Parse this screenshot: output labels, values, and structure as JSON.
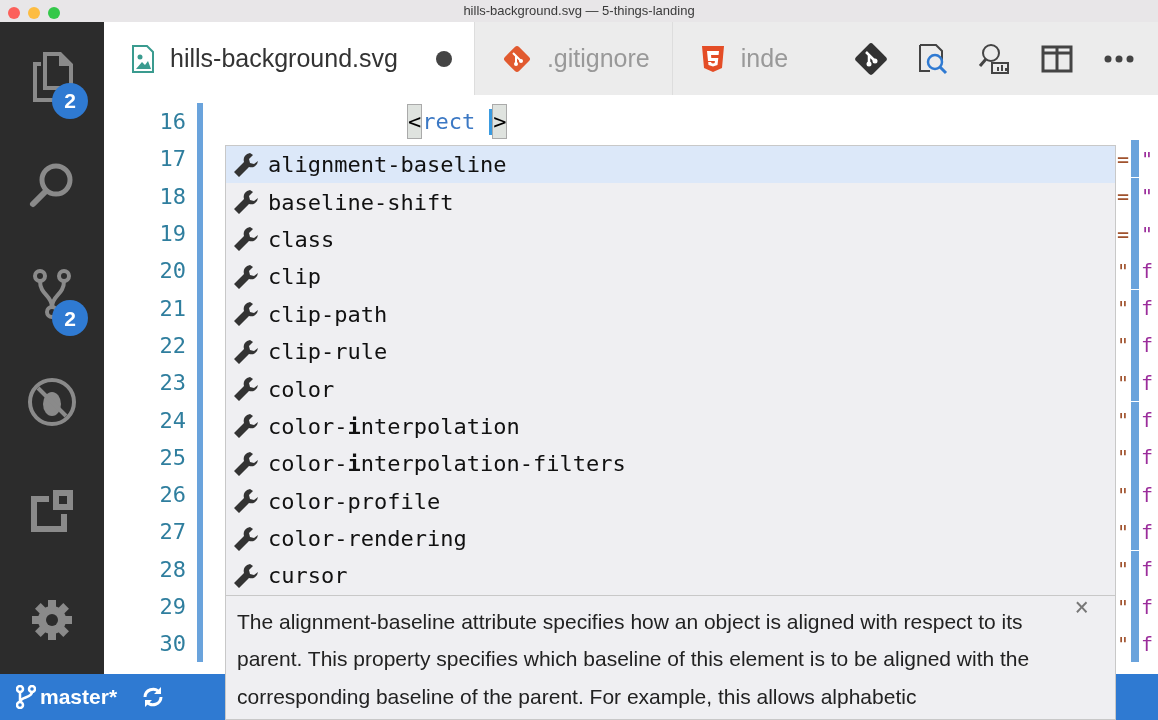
{
  "window": {
    "title": "hills-background.svg — 5-things-landing"
  },
  "activity_bar": [
    {
      "kind": "files",
      "badge": "2"
    },
    {
      "kind": "search"
    },
    {
      "kind": "source-control",
      "badge": "2"
    },
    {
      "kind": "debug"
    },
    {
      "kind": "extensions"
    }
  ],
  "tabs": [
    {
      "label": "hills-background.svg",
      "kind": "image",
      "selected": true,
      "dirty": true
    },
    {
      "label": ".gitignore",
      "kind": "git",
      "selected": false,
      "dirty": false
    },
    {
      "label": "inde",
      "kind": "html",
      "selected": false,
      "dirty": false
    }
  ],
  "editor": {
    "lines": [
      {
        "number": "16",
        "tokens": [
          {
            "text": "<",
            "kind": "bracket"
          },
          {
            "text": "rect",
            "kind": "tag"
          },
          {
            "text": ">",
            "kind": "bracket"
          }
        ]
      },
      {
        "number": "17",
        "edge_left": "=",
        "edge_right": "\""
      },
      {
        "number": "18",
        "edge_left": "=",
        "edge_right": "\""
      },
      {
        "number": "19",
        "edge_left": "=",
        "edge_right": "\""
      },
      {
        "number": "20",
        "edge_left": "\"",
        "edge_right": "f"
      },
      {
        "number": "21",
        "edge_left": "\"",
        "edge_right": "f"
      },
      {
        "number": "22",
        "edge_left": "\"",
        "edge_right": "f"
      },
      {
        "number": "23",
        "edge_left": "\"",
        "edge_right": "f"
      },
      {
        "number": "24",
        "edge_left": "\"",
        "edge_right": "f"
      },
      {
        "number": "25",
        "edge_left": "\"",
        "edge_right": "f"
      },
      {
        "number": "26",
        "edge_left": "\"",
        "edge_right": "f"
      },
      {
        "number": "27",
        "edge_left": "\"",
        "edge_right": "f"
      },
      {
        "number": "28",
        "edge_left": "\"",
        "edge_right": "f"
      },
      {
        "number": "29",
        "edge_left": "\"",
        "edge_right": "f"
      },
      {
        "number": "30",
        "edge_left": "\"",
        "edge_right": "f"
      }
    ]
  },
  "suggestions": {
    "items": [
      {
        "label": "alignment-baseline",
        "selected": true
      },
      {
        "label": "baseline-shift",
        "selected": false
      },
      {
        "label": "class",
        "selected": false
      },
      {
        "label": "clip",
        "selected": false
      },
      {
        "label": "clip-path",
        "selected": false
      },
      {
        "label": "clip-rule",
        "selected": false
      },
      {
        "label": "color",
        "selected": false
      },
      {
        "label": "color-**i**nterpolation",
        "selected": false
      },
      {
        "label": "color-**i**nterpolation-filters",
        "selected": false
      },
      {
        "label": "color-profile",
        "selected": false
      },
      {
        "label": "color-rendering",
        "selected": false
      },
      {
        "label": "cursor",
        "selected": false
      }
    ],
    "details": "The alignment-baseline attribute specifies how an object is aligned with respect to its parent. This property specifies which baseline of this element is to be aligned with the corresponding baseline of the parent. For example, this allows alphabetic",
    "close": "×"
  },
  "status_bar": {
    "branch": "master*"
  }
}
